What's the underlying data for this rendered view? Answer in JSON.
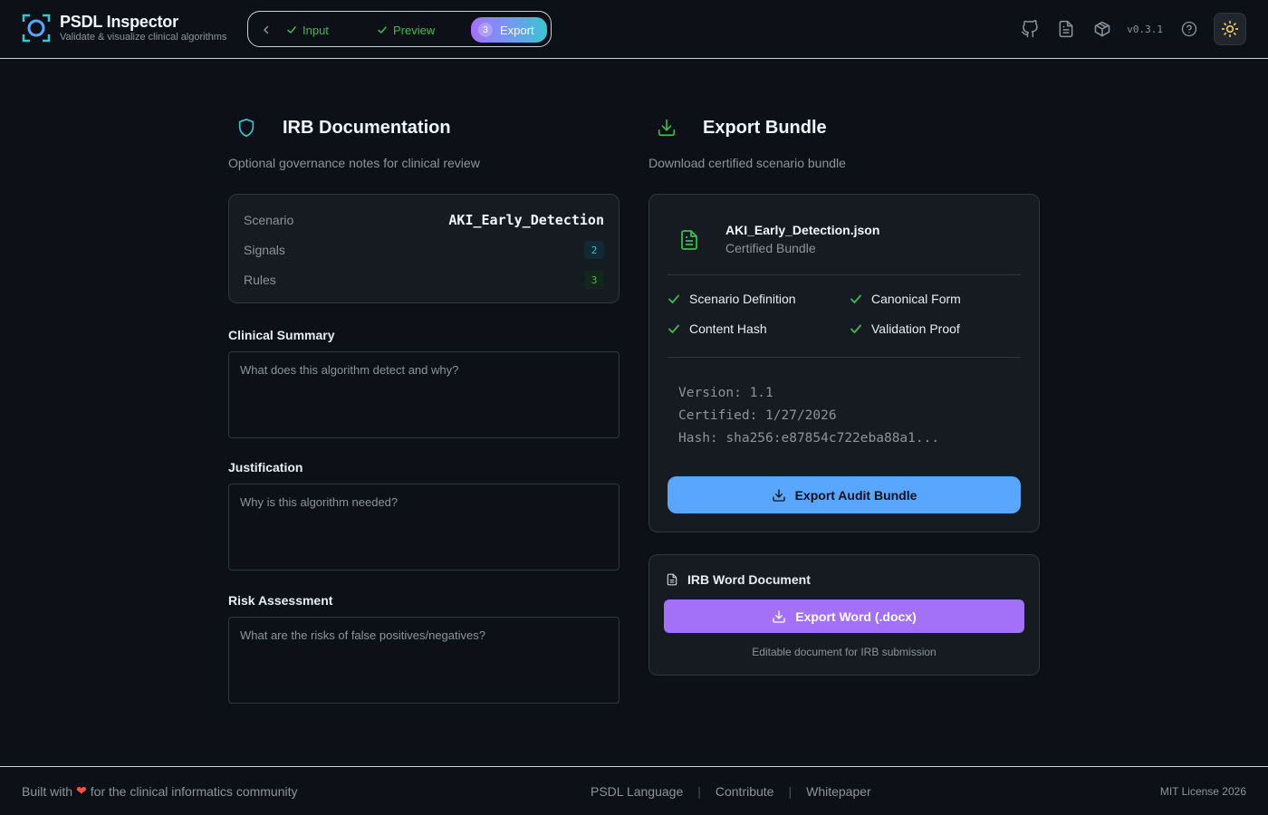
{
  "app": {
    "title": "PSDL Inspector",
    "subtitle": "Validate & visualize clinical algorithms",
    "version": "v0.3.1"
  },
  "stepper": {
    "steps": [
      {
        "label": "Input",
        "state": "done"
      },
      {
        "label": "Preview",
        "state": "done"
      },
      {
        "label": "Export",
        "number": "3",
        "state": "active"
      }
    ]
  },
  "header_icons": [
    "github-icon",
    "document-icon",
    "package-icon",
    "help-icon",
    "sun-icon"
  ],
  "irb": {
    "title": "IRB Documentation",
    "subtitle": "Optional governance notes for clinical review",
    "summary": {
      "scenario_label": "Scenario",
      "scenario_value": "AKI_Early_Detection",
      "signals_label": "Signals",
      "signals_value": "2",
      "rules_label": "Rules",
      "rules_value": "3"
    },
    "fields": [
      {
        "label": "Clinical Summary",
        "placeholder": "What does this algorithm detect and why?",
        "value": ""
      },
      {
        "label": "Justification",
        "placeholder": "Why is this algorithm needed?",
        "value": ""
      },
      {
        "label": "Risk Assessment",
        "placeholder": "What are the risks of false positives/negatives?",
        "value": ""
      }
    ]
  },
  "export": {
    "title": "Export Bundle",
    "subtitle": "Download certified scenario bundle",
    "file_name": "AKI_Early_Detection.json",
    "file_type": "Certified Bundle",
    "checks": [
      "Scenario Definition",
      "Canonical Form",
      "Content Hash",
      "Validation Proof"
    ],
    "meta": {
      "version": "Version: 1.1",
      "certified": "Certified: 1/27/2026",
      "hash": "Hash: sha256:e87854c722eba88a1..."
    },
    "audit_button": "Export Audit Bundle",
    "word": {
      "title": "IRB Word Document",
      "button": "Export Word (.docx)",
      "note": "Editable document for IRB submission"
    }
  },
  "footer": {
    "built_prefix": "Built with",
    "built_suffix": "for the clinical informatics community",
    "links": [
      "PSDL Language",
      "Contribute",
      "Whitepaper"
    ],
    "license": "MIT License 2026"
  },
  "colors": {
    "accent_blue": "#58a6ff",
    "accent_purple": "#a371f7",
    "success_green": "#3fb950",
    "teal": "#39c5cf",
    "background": "#0d1117"
  }
}
